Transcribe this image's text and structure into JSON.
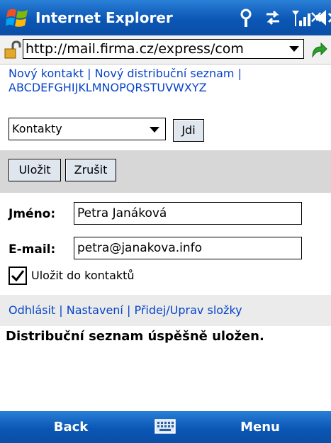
{
  "titlebar": {
    "app_title": "Internet Explorer",
    "close_label": "✕"
  },
  "address": {
    "url": "http://mail.firma.cz/express/com"
  },
  "nav": {
    "new_contact": "Nový kontakt",
    "separator": "|",
    "new_distribution_list": "Nový distribuční seznam",
    "alphabet": "ABCDEFGHIJKLMNOPQRSTUVWXYZ"
  },
  "folder": {
    "selected": "Kontakty",
    "go_label": "Jdi"
  },
  "toolbar": {
    "save_label": "Uložit",
    "cancel_label": "Zrušit"
  },
  "form": {
    "name_label": "Jméno:",
    "name_value": "Petra Janáková",
    "email_label": "E-mail:",
    "email_value": "petra@janakova.info",
    "save_to_contacts_label": "Uložit do kontaktů",
    "save_to_contacts_checked": true
  },
  "footer_links": {
    "logout": "Odhlásit",
    "settings": "Nastavení",
    "folders": "Přidej/Uprav složky"
  },
  "status_message": "Distribuční seznam úspěšně uložen.",
  "softkeys": {
    "left": "Back",
    "right": "Menu"
  },
  "icons": {
    "windows_flag": "windows-start-icon",
    "signal": "antenna-icon",
    "sync": "activesync-icon",
    "cellular": "signal-strength-icon",
    "volume": "speaker-icon",
    "lock": "lock-icon",
    "go": "go-arrow-icon",
    "keyboard": "keyboard-icon"
  }
}
